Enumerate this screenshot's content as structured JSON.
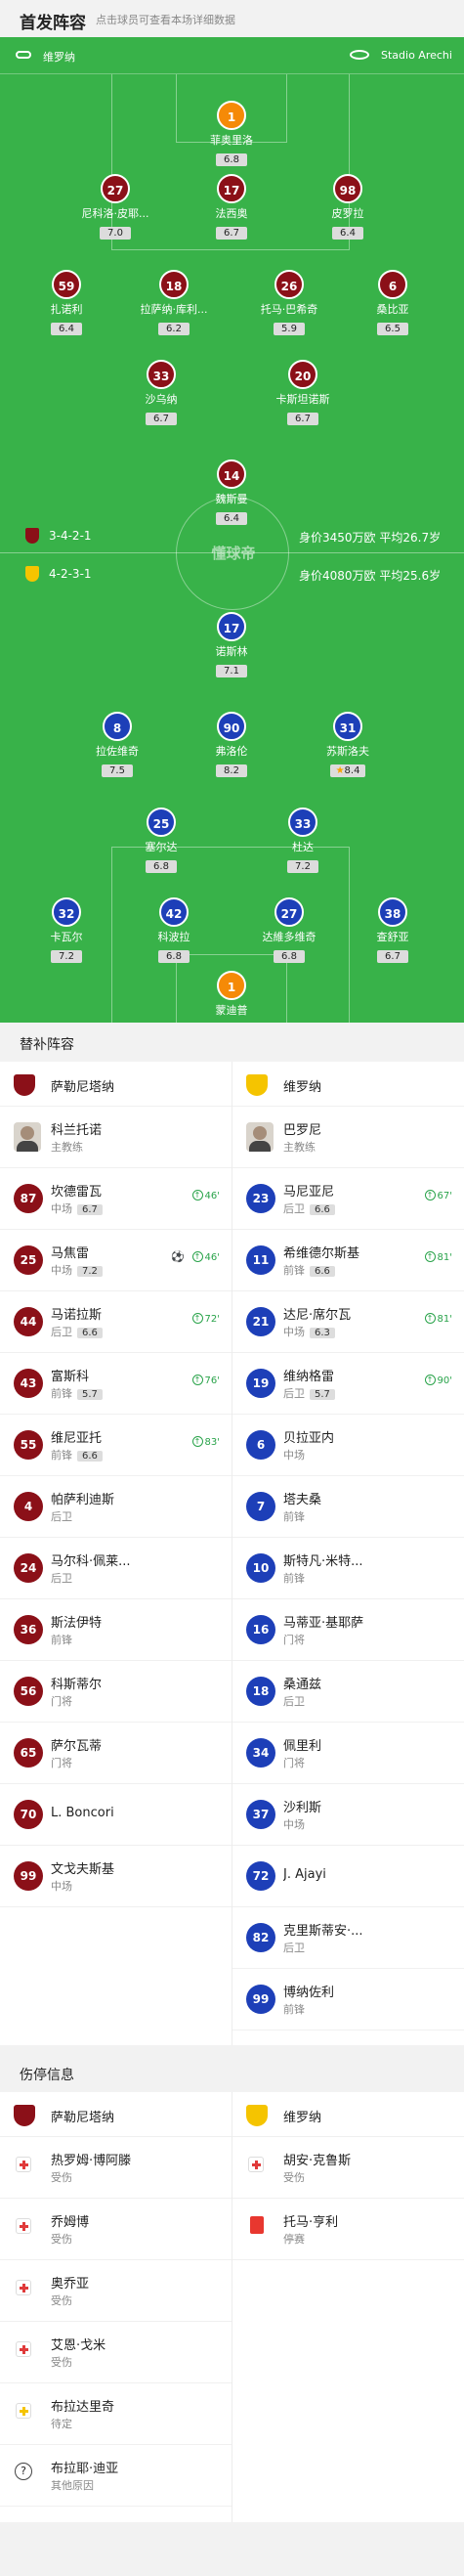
{
  "header": {
    "title": "首发阵容",
    "subtitle": "点击球员可查看本场详细数据"
  },
  "pitch": {
    "home_team": "维罗纳",
    "venue": "Stadio Arechi",
    "watermark": "懂球帝",
    "salernitana": {
      "formation": "3-4-2-1",
      "value": "身价3450万欧 平均26.7岁"
    },
    "verona": {
      "formation": "4-2-3-1",
      "value": "身价4080万欧 平均25.6岁"
    },
    "players": [
      {
        "id": "p1",
        "team": "gk",
        "num": "1",
        "name": "菲奥里洛",
        "rating": "6.8"
      },
      {
        "id": "p2",
        "team": "red",
        "num": "27",
        "name": "尼科洛·皮耶...",
        "rating": "7.0"
      },
      {
        "id": "p3",
        "team": "red",
        "num": "17",
        "name": "法西奥",
        "rating": "6.7",
        "sub": "72'",
        "captain": "C"
      },
      {
        "id": "p4",
        "team": "red",
        "num": "98",
        "name": "皮罗拉",
        "rating": "6.4",
        "sub": "46'"
      },
      {
        "id": "p5",
        "team": "red",
        "num": "59",
        "name": "扎诺利",
        "rating": "6.4"
      },
      {
        "id": "p6",
        "team": "red",
        "num": "18",
        "name": "拉萨纳·库利...",
        "rating": "6.2",
        "sub": "46'"
      },
      {
        "id": "p7",
        "team": "red",
        "num": "26",
        "name": "托马·巴希奇",
        "rating": "5.9"
      },
      {
        "id": "p8",
        "team": "red",
        "num": "6",
        "name": "桑比亚",
        "rating": "6.5"
      },
      {
        "id": "p9",
        "team": "red",
        "num": "33",
        "name": "沙乌纳",
        "rating": "6.7"
      },
      {
        "id": "p10",
        "team": "red",
        "num": "20",
        "name": "卡斯坦诺斯",
        "rating": "6.7",
        "sub": "83'"
      },
      {
        "id": "p11",
        "team": "red",
        "num": "14",
        "name": "魏斯曼",
        "rating": "6.4",
        "sub": "76'"
      },
      {
        "id": "q1",
        "team": "blue",
        "num": "17",
        "name": "诺斯林",
        "rating": "7.1"
      },
      {
        "id": "q2",
        "team": "blue",
        "num": "8",
        "name": "拉佐维奇",
        "rating": "7.5",
        "sub": "90'",
        "captain": "C"
      },
      {
        "id": "q3",
        "team": "blue",
        "num": "90",
        "name": "弗洛伦",
        "rating": "8.2",
        "sub": "81'"
      },
      {
        "id": "q4",
        "team": "blue",
        "num": "31",
        "name": "苏斯洛夫",
        "rating": "8.4",
        "sub": "81'",
        "star": "★"
      },
      {
        "id": "q5",
        "team": "blue",
        "num": "25",
        "name": "塞尔达",
        "rating": "6.8"
      },
      {
        "id": "q6",
        "team": "blue",
        "num": "33",
        "name": "杜达",
        "rating": "7.2"
      },
      {
        "id": "q7",
        "team": "blue",
        "num": "32",
        "name": "卡瓦尔",
        "rating": "7.2",
        "sub": "67'"
      },
      {
        "id": "q8",
        "team": "blue",
        "num": "42",
        "name": "科波拉",
        "rating": "6.8"
      },
      {
        "id": "q9",
        "team": "blue",
        "num": "27",
        "name": "达維多维奇",
        "rating": "6.8"
      },
      {
        "id": "q10",
        "team": "blue",
        "num": "38",
        "name": "查舒亚",
        "rating": "6.7"
      },
      {
        "id": "q11",
        "team": "gk",
        "num": "1",
        "name": "蒙迪普",
        "rating": "6.4"
      }
    ]
  },
  "subs": {
    "title": "替补阵容",
    "left_team": "萨勒尼塔纳",
    "right_team": "维罗纳",
    "left_coach": {
      "name": "科兰托诺",
      "role": "主教练"
    },
    "right_coach": {
      "name": "巴罗尼",
      "role": "主教练"
    },
    "left": [
      {
        "num": "87",
        "name": "坎德雷瓦",
        "pos": "中场",
        "rating": "6.7",
        "min": "46'"
      },
      {
        "num": "25",
        "name": "马焦雷",
        "pos": "中场",
        "rating": "7.2",
        "min": "46'",
        "goal": "⚽"
      },
      {
        "num": "44",
        "name": "马诺拉斯",
        "pos": "后卫",
        "rating": "6.6",
        "min": "72'"
      },
      {
        "num": "43",
        "name": "富斯科",
        "pos": "前锋",
        "rating": "5.7",
        "min": "76'"
      },
      {
        "num": "55",
        "name": "维尼亚托",
        "pos": "前锋",
        "rating": "6.6",
        "min": "83'"
      },
      {
        "num": "4",
        "name": "帕萨利迪斯",
        "pos": "后卫"
      },
      {
        "num": "24",
        "name": "马尔科·佩莱...",
        "pos": "后卫"
      },
      {
        "num": "36",
        "name": "斯法伊特",
        "pos": "前锋"
      },
      {
        "num": "56",
        "name": "科斯蒂尔",
        "pos": "门将"
      },
      {
        "num": "65",
        "name": "萨尔瓦蒂",
        "pos": "门将"
      },
      {
        "num": "70",
        "name": "L. Boncori",
        "pos": ""
      },
      {
        "num": "99",
        "name": "文戈夫斯基",
        "pos": "中场"
      }
    ],
    "right": [
      {
        "num": "23",
        "name": "马尼亚尼",
        "pos": "后卫",
        "rating": "6.6",
        "min": "67'"
      },
      {
        "num": "11",
        "name": "希维德尔斯基",
        "pos": "前锋",
        "rating": "6.6",
        "min": "81'"
      },
      {
        "num": "21",
        "name": "达尼·席尔瓦",
        "pos": "中场",
        "rating": "6.3",
        "min": "81'"
      },
      {
        "num": "19",
        "name": "维纳格雷",
        "pos": "后卫",
        "rating": "5.7",
        "min": "90'"
      },
      {
        "num": "6",
        "name": "贝拉亚内",
        "pos": "中场"
      },
      {
        "num": "7",
        "name": "塔夫桑",
        "pos": "前锋"
      },
      {
        "num": "10",
        "name": "斯特凡·米特...",
        "pos": "前锋"
      },
      {
        "num": "16",
        "name": "马蒂亚·基耶萨",
        "pos": "门将"
      },
      {
        "num": "18",
        "name": "桑通兹",
        "pos": "后卫"
      },
      {
        "num": "34",
        "name": "佩里利",
        "pos": "门将"
      },
      {
        "num": "37",
        "name": "沙利斯",
        "pos": "中场"
      },
      {
        "num": "72",
        "name": "J. Ajayi",
        "pos": ""
      },
      {
        "num": "82",
        "name": "克里斯蒂安·...",
        "pos": "后卫"
      },
      {
        "num": "99",
        "name": "博纳佐利",
        "pos": "前锋"
      }
    ]
  },
  "injuries": {
    "title": "伤停信息",
    "left_team": "萨勒尼塔纳",
    "right_team": "维罗纳",
    "left": [
      {
        "icon": "injury",
        "name": "热罗姆·博阿滕",
        "reason": "受伤"
      },
      {
        "icon": "injury",
        "name": "乔姆博",
        "reason": "受伤"
      },
      {
        "icon": "injury",
        "name": "奥乔亚",
        "reason": "受伤"
      },
      {
        "icon": "injury",
        "name": "艾恩·戈米",
        "reason": "受伤"
      },
      {
        "icon": "doubt",
        "name": "布拉达里奇",
        "reason": "待定"
      },
      {
        "icon": "other",
        "name": "布拉耶·迪亚",
        "reason": "其他原因"
      }
    ],
    "right": [
      {
        "icon": "injury",
        "name": "胡安·克鲁斯",
        "reason": "受伤"
      },
      {
        "icon": "red-card",
        "name": "托马·亨利",
        "reason": "停赛"
      }
    ]
  },
  "colors": {
    "pitch": "#38b249",
    "home": "#8b1018",
    "away": "#1d3fb8",
    "gk": "#f58a07"
  }
}
